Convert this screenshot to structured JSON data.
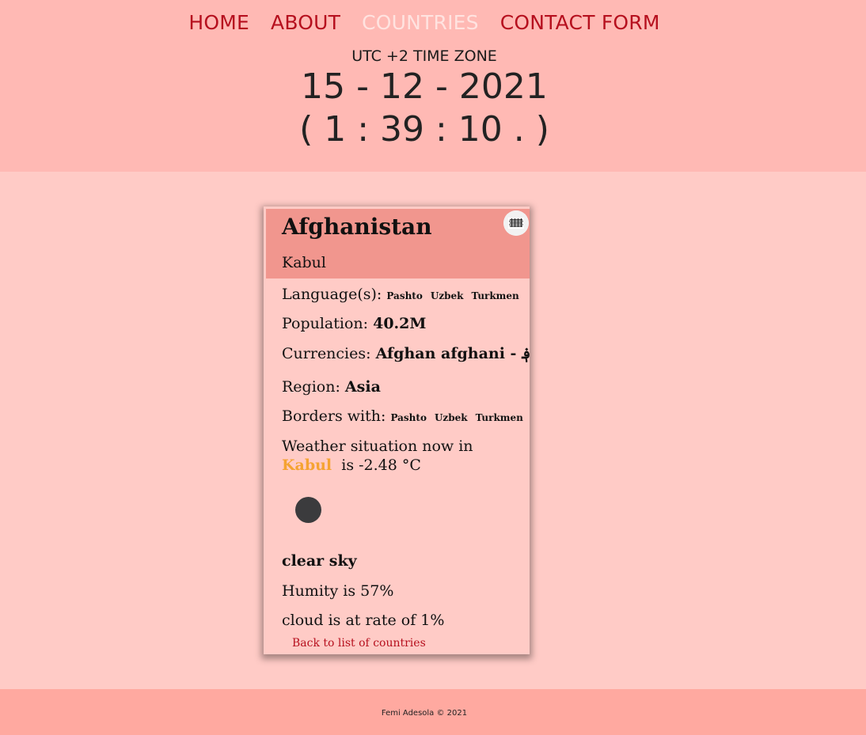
{
  "nav": {
    "home": "HOME",
    "about": "ABOUT",
    "countries": "COUNTRIES",
    "contact": "CONTACT FORM"
  },
  "clock": {
    "timezone": "UTC +2 TIME ZONE",
    "date": "15 - 12 - 2021",
    "time": "( 1 : 39 : 10 . )"
  },
  "country": {
    "name": "Afghanistan",
    "capital": "Kabul",
    "languages_label": "Language(s):",
    "languages": [
      "Pashto",
      "Uzbek",
      "Turkmen"
    ],
    "population_label": "Population:",
    "population": "40.2M",
    "currencies_label": "Currencies:",
    "currencies": "Afghan afghani - ؋",
    "region_label": "Region:",
    "region": "Asia",
    "borders_label": "Borders with:",
    "borders": [
      "Pashto",
      "Uzbek",
      "Turkmen"
    ]
  },
  "weather": {
    "prefix": "Weather situation now in",
    "city": "Kabul",
    "is_text": "is",
    "temperature": "-2.48 °C",
    "description": "clear sky",
    "humidity": "Humity is 57%",
    "cloud": "cloud is at rate of 1%"
  },
  "links": {
    "back": "Back to list of countries"
  },
  "footer": {
    "text": "Femi Adesola © 2021"
  },
  "icons": {
    "flag": "afghanistan-flag-icon",
    "weather": "weather-icon"
  }
}
